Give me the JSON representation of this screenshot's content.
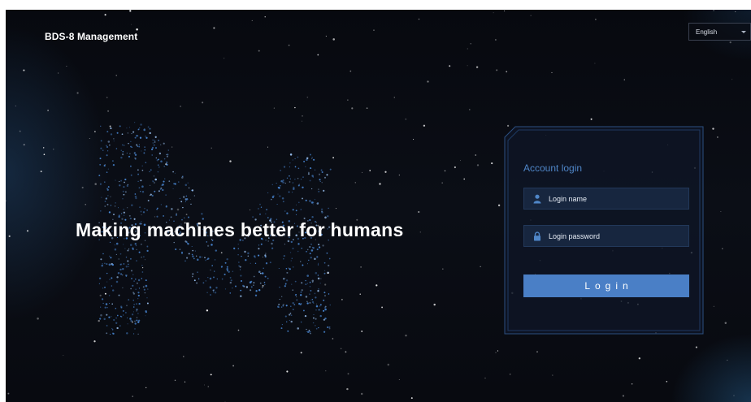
{
  "header": {
    "brand": "BDS-8 Management",
    "language_select": {
      "selected": "English",
      "icon": "chevron-down-icon"
    }
  },
  "hero": {
    "slogan": "Making machines better for humans",
    "logo": "dotted-m-logo"
  },
  "login": {
    "title": "Account login",
    "username_placeholder": "Login name",
    "username_icon": "user-icon",
    "password_placeholder": "Login password",
    "password_icon": "lock-icon",
    "submit_label": "Login"
  },
  "colors": {
    "background": "#0a0c12",
    "accent": "#4a7fc6",
    "title_blue": "#4f86c8",
    "field_bg": "#17263f",
    "dot_blue": "#4d8fe0"
  }
}
